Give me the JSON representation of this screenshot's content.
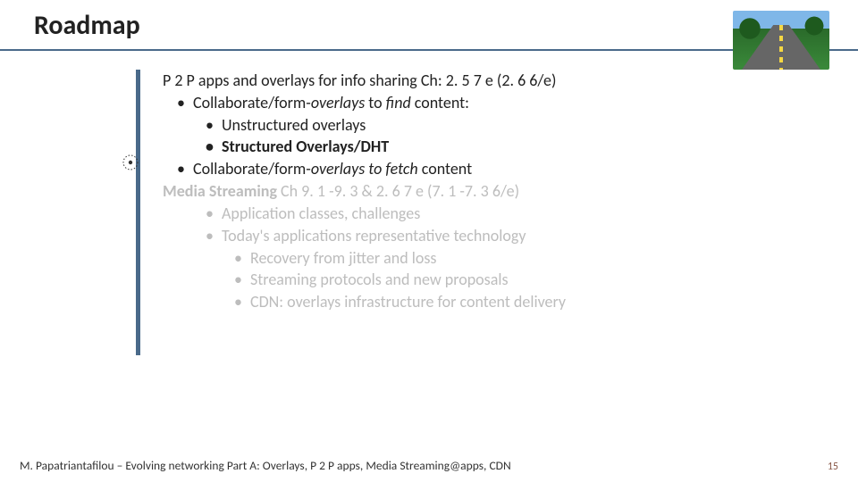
{
  "title": "Roadmap",
  "section1_heading": "P 2 P apps and overlays  for info sharing Ch: 2. 5 7 e (2. 6 6/e)",
  "s1_b1_pre": "Collaborate/form-",
  "s1_b1_mid": "overlays",
  "s1_b1_post": " to ",
  "s1_b1_find": "find",
  "s1_b1_tail": " content:",
  "s1_b1a": "Unstructured overlays",
  "s1_b1b": "Structured Overlays/DHT",
  "s1_b2_pre": "Collaborate/form-",
  "s1_b2_mid": "overlays to fetch",
  "s1_b2_post": " content",
  "section2_lead": "Media Streaming ",
  "section2_rest": "Ch 9. 1 -9. 3 & 2. 6 7 e (7. 1 -7. 3 6/e)",
  "s2_b1": "Application classes, challenges",
  "s2_b2": "Today's applications representative technology",
  "s2_b2a": "Recovery from jitter and loss",
  "s2_b2b": "Streaming protocols and new proposals",
  "s2_b2c": "CDN: overlays infrastructure for content delivery",
  "footer": "M. Papatriantafilou –  Evolving networking Part A: Overlays, P 2 P apps, Media Streaming@apps, CDN",
  "page": "15"
}
